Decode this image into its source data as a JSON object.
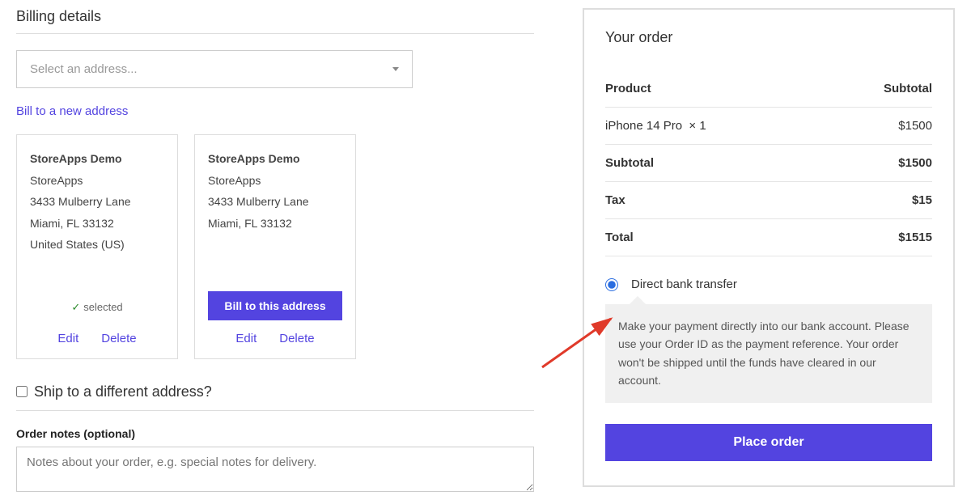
{
  "billing": {
    "title": "Billing details",
    "select_placeholder": "Select an address...",
    "new_address_link": "Bill to a new address",
    "addresses": [
      {
        "name": "StoreApps Demo",
        "company": "StoreApps",
        "street": "3433 Mulberry Lane",
        "city_line": "Miami, FL 33132",
        "country": "United States (US)",
        "selected_label": "selected",
        "edit": "Edit",
        "delete": "Delete"
      },
      {
        "name": "StoreApps Demo",
        "company": "StoreApps",
        "street": "3433 Mulberry Lane",
        "city_line": "Miami, FL 33132",
        "country": "",
        "bill_button": "Bill to this address",
        "edit": "Edit",
        "delete": "Delete"
      }
    ]
  },
  "ship": {
    "label": "Ship to a different address?"
  },
  "notes": {
    "label": "Order notes (optional)",
    "placeholder": "Notes about your order, e.g. special notes for delivery."
  },
  "order": {
    "title": "Your order",
    "headers": {
      "product": "Product",
      "subtotal": "Subtotal"
    },
    "item": {
      "name": "iPhone 14 Pro",
      "qty": "× 1",
      "price": "$1500"
    },
    "subtotal": {
      "label": "Subtotal",
      "value": "$1500"
    },
    "tax": {
      "label": "Tax",
      "value": "$15"
    },
    "total": {
      "label": "Total",
      "value": "$1515"
    },
    "payment": {
      "method": "Direct bank transfer",
      "description": "Make your payment directly into our bank account. Please use your Order ID as the payment reference. Your order won't be shipped until the funds have cleared in our account."
    },
    "place_order": "Place order"
  }
}
